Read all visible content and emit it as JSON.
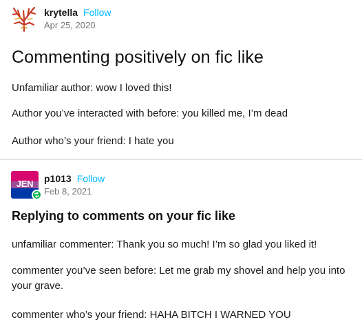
{
  "post1": {
    "username": "krytella",
    "follow_label": "Follow",
    "date": "Apr 25, 2020",
    "avatar_icon": "coral-avatar-icon",
    "title": "Commenting positively on fic like",
    "lines": [
      "Unfamiliar author: wow I loved this!",
      "Author you’ve interacted with before: you killed me, I’m dead",
      "Author who’s your friend: I hate you"
    ]
  },
  "post2": {
    "username": "p1013",
    "follow_label": "Follow",
    "date": "Feb 8, 2021",
    "avatar_text": "JEN",
    "avatar_icon": "reblog-icon",
    "title": "Replying to comments on your fic like",
    "lines": [
      "unfamiliar commenter: Thank you so much! I’m so glad you liked it!",
      "commenter you’ve seen before: Let me grab my shovel and help you into your grave.",
      "commenter who’s your friend: HAHA BITCH I WARNED YOU"
    ]
  },
  "colors": {
    "follow": "#00b8ff",
    "date": "#757575",
    "reblog_badge": "#00b34a",
    "divider": "#dddddd",
    "avatar_pink": "#d6086f",
    "avatar_purple": "#9b4f96",
    "avatar_blue": "#0038a8"
  }
}
